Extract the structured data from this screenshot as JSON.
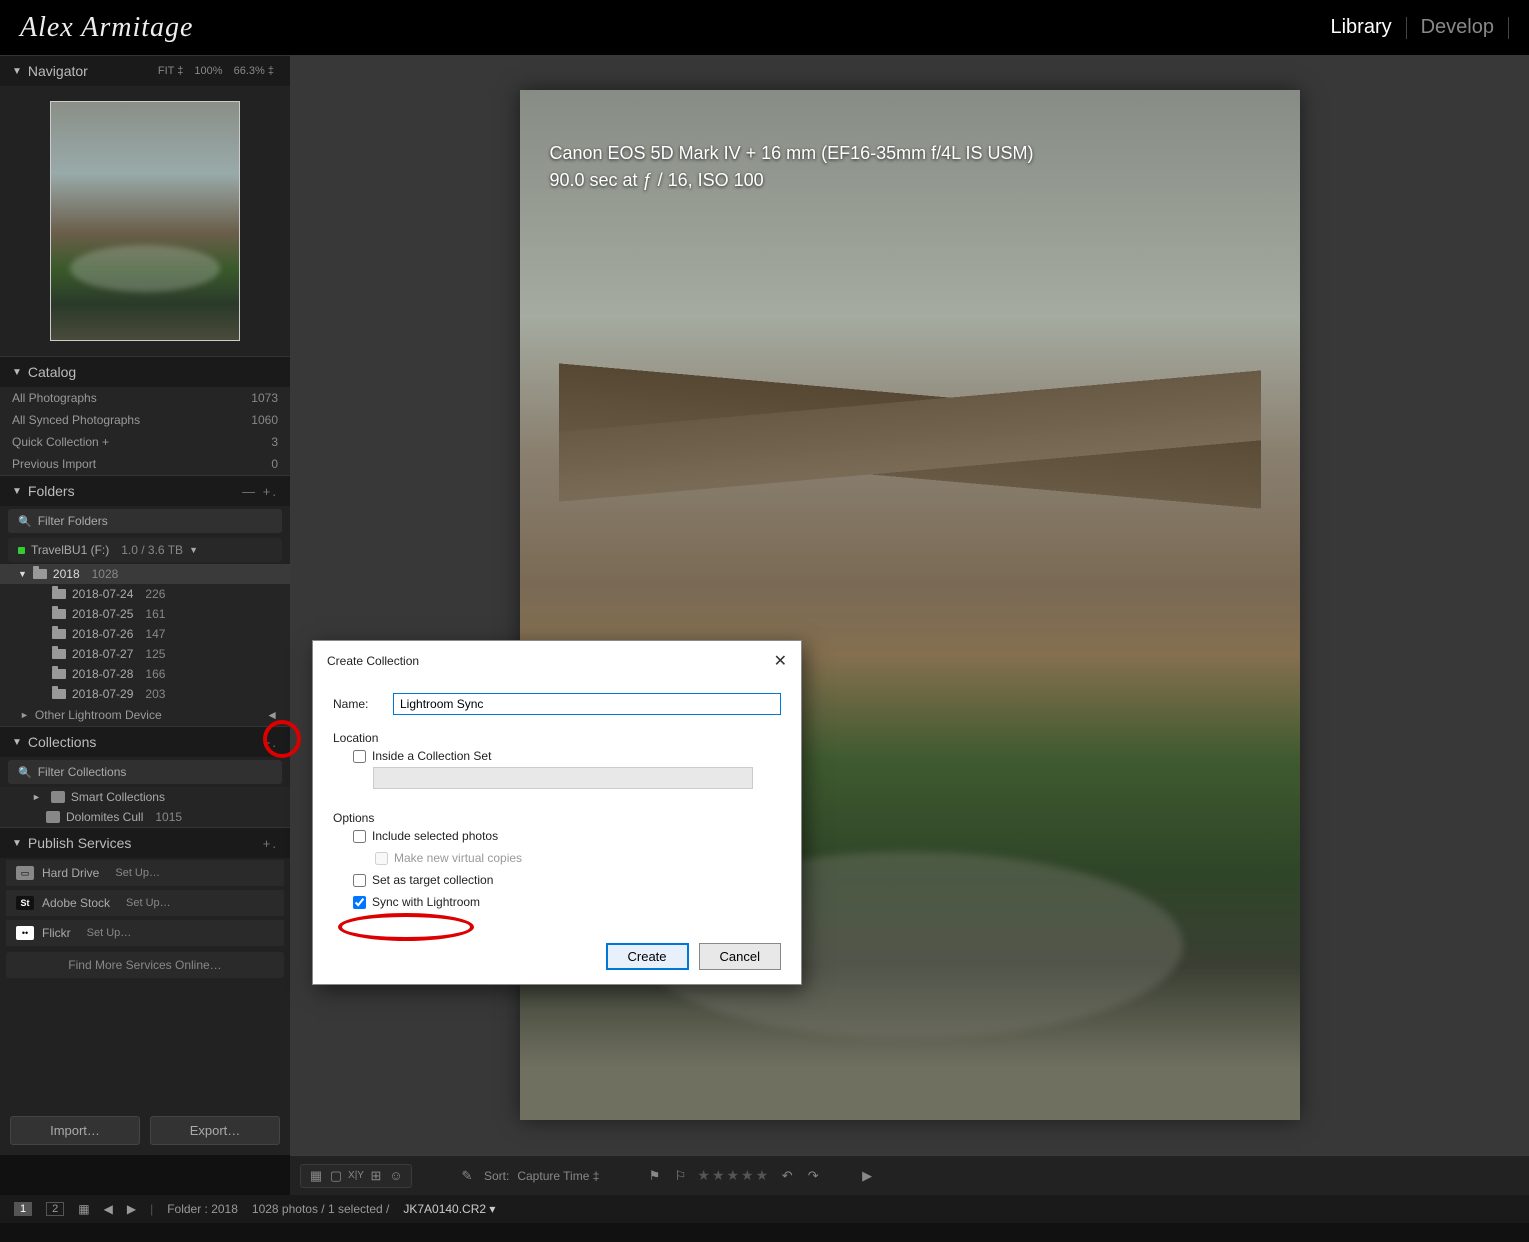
{
  "topbar": {
    "logo_text": "Alex Armitage",
    "tabs": {
      "library": "Library",
      "develop": "Develop"
    }
  },
  "navigator": {
    "title": "Navigator",
    "zoom": {
      "fit": "FIT ‡",
      "z100": "100%",
      "z66": "66.3% ‡"
    }
  },
  "catalog": {
    "title": "Catalog",
    "rows": [
      {
        "label": "All Photographs",
        "count": "1073"
      },
      {
        "label": "All Synced Photographs",
        "count": "1060"
      },
      {
        "label": "Quick Collection  +",
        "count": "3"
      },
      {
        "label": "Previous Import",
        "count": "0"
      }
    ]
  },
  "folders": {
    "title": "Folders",
    "filter_placeholder": "Filter Folders",
    "drive_name": "TravelBU1 (F:)",
    "drive_space": "1.0 / 3.6 TB",
    "root": {
      "name": "2018",
      "count": "1028"
    },
    "subs": [
      {
        "name": "2018-07-24",
        "count": "226"
      },
      {
        "name": "2018-07-25",
        "count": "161"
      },
      {
        "name": "2018-07-26",
        "count": "147"
      },
      {
        "name": "2018-07-27",
        "count": "125"
      },
      {
        "name": "2018-07-28",
        "count": "166"
      },
      {
        "name": "2018-07-29",
        "count": "203"
      }
    ],
    "other_device": "Other Lightroom Device"
  },
  "collections": {
    "title": "Collections",
    "filter_placeholder": "Filter Collections",
    "items": [
      {
        "name": "Smart Collections",
        "count": ""
      },
      {
        "name": "Dolomites Cull",
        "count": "1015"
      }
    ]
  },
  "publish": {
    "title": "Publish Services",
    "services": [
      {
        "icon": "▭",
        "name": "Hard Drive",
        "action": "Set Up…"
      },
      {
        "icon": "St",
        "name": "Adobe Stock",
        "action": "Set Up…"
      },
      {
        "icon": "••",
        "name": "Flickr",
        "action": "Set Up…"
      }
    ],
    "find_more": "Find More Services Online…"
  },
  "bottom_buttons": {
    "import": "Import…",
    "export": "Export…"
  },
  "dialog": {
    "title": "Create Collection",
    "name_label": "Name:",
    "name_value": "Lightroom Sync",
    "location_label": "Location",
    "inside_label": "Inside a Collection Set",
    "options_label": "Options",
    "include_label": "Include selected photos",
    "virtual_label": "Make new virtual copies",
    "target_label": "Set as target collection",
    "sync_label": "Sync with Lightroom",
    "create": "Create",
    "cancel": "Cancel"
  },
  "image_meta": {
    "line1": "Canon EOS 5D Mark IV + 16 mm (EF16-35mm f/4L IS USM)",
    "line2": "90.0 sec at ƒ / 16, ISO 100"
  },
  "toolbar": {
    "sort_label": "Sort:",
    "sort_value": "Capture Time  ‡"
  },
  "status": {
    "page1": "1",
    "page2": "2",
    "folder_label": "Folder : 2018",
    "count_label": "1028 photos / 1 selected /",
    "filename": "JK7A0140.CR2 ▾"
  }
}
